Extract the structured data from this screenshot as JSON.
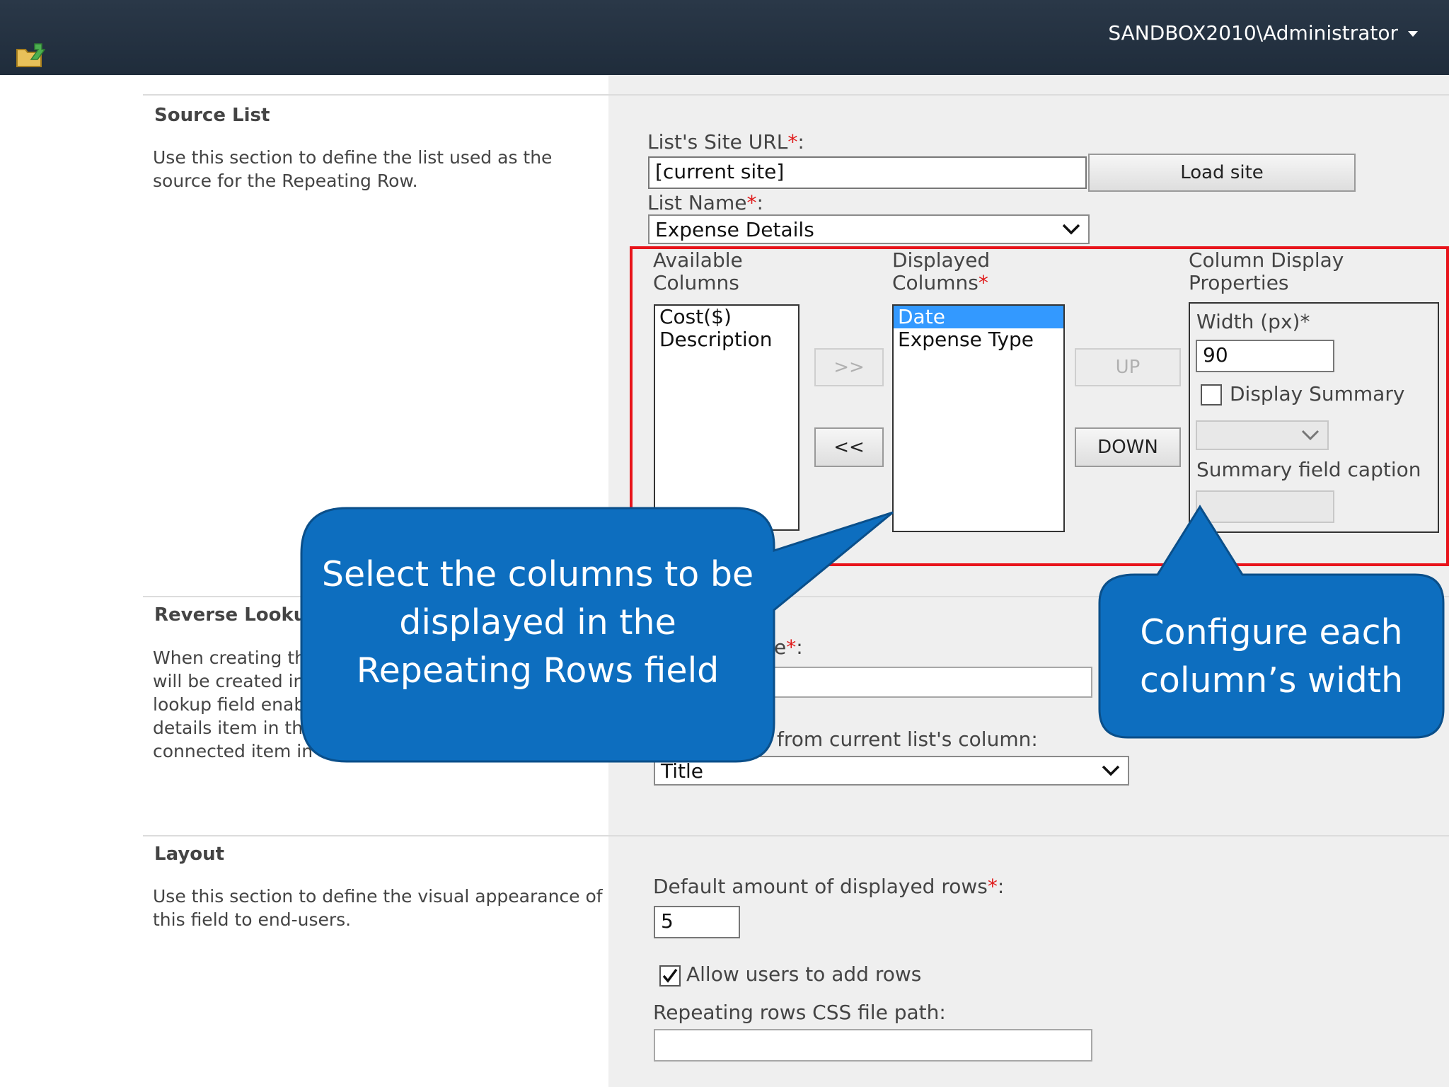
{
  "header": {
    "user": "SANDBOX2010\\Administrator"
  },
  "source_list": {
    "title": "Source List",
    "description_line1": "Use this section to define the list used as the",
    "description_line2": "source for the Repeating Row.",
    "site_url_label": "List's Site URL",
    "site_url_value": "[current site]",
    "load_site_button": "Load site",
    "list_name_label": "List Name",
    "list_name_value": "Expense Details",
    "required_mark": "*",
    "colon": ":"
  },
  "columns": {
    "available_label_line1": "Available",
    "available_label_line2": "Columns",
    "available_items": [
      "Cost($)",
      "Description"
    ],
    "displayed_label_line1": "Displayed",
    "displayed_label_line2": "Columns",
    "displayed_items": [
      "Date",
      "Expense Type"
    ],
    "add_button": ">>",
    "remove_button": "<<",
    "up_button": "UP",
    "down_button": "DOWN",
    "props_label_line1": "Column Display",
    "props_label_line2": "Properties",
    "width_label": "Width (px)*",
    "width_value": "90",
    "display_summary_label": "Display Summary",
    "summary_caption_label": "Summary field caption"
  },
  "reverse_lookup": {
    "title": "Reverse Lookup",
    "desc_line1": "When creating thi",
    "desc_line2": "will be created in",
    "desc_line3": "lookup field enabl",
    "desc_line4": "details item in the",
    "desc_line5": "connected item in t",
    "field_label_fragment": "e",
    "from_column_label": "from current list's column:",
    "from_column_value": "Title"
  },
  "layout": {
    "title": "Layout",
    "desc_line1": "Use this section to define the visual appearance of",
    "desc_line2": "this field to end-users.",
    "default_rows_label": "Default amount of displayed rows",
    "default_rows_value": "5",
    "allow_add_rows_label": "Allow users to add rows",
    "allow_add_rows_checked": true,
    "css_path_label": "Repeating rows CSS file path:"
  },
  "callouts": {
    "left_line1": "Select the columns to be",
    "left_line2": "displayed in the",
    "left_line3": "Repeating Rows field",
    "right_line1": "Configure each",
    "right_line2": "column’s width"
  },
  "colors": {
    "topbar": "#1f2c3b",
    "callout": "#0d6ebf",
    "highlight": "#e8141b",
    "selected": "#3399ff"
  }
}
